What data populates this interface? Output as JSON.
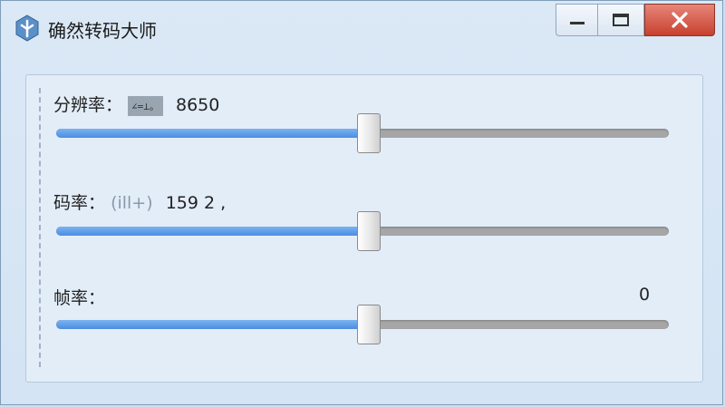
{
  "window": {
    "title": "确然转码大师",
    "icon": "app-logo-icon",
    "controls": {
      "minimize": "minimize-icon",
      "maximize": "restore-icon",
      "close": "close-icon"
    }
  },
  "resolution": {
    "label": "分辨率：",
    "chip_text": "∠=⊥。",
    "value": "8650",
    "level": 0.51
  },
  "bitrate": {
    "label": "码率：",
    "unit": "(ill+)",
    "value": "159  2 ,",
    "level": 0.51
  },
  "framerate": {
    "label": "帧率：",
    "value": "0",
    "level": 0.51
  },
  "colors": {
    "accent": "#4a8de0",
    "track": "#a6a6a6",
    "close": "#c7402d"
  }
}
